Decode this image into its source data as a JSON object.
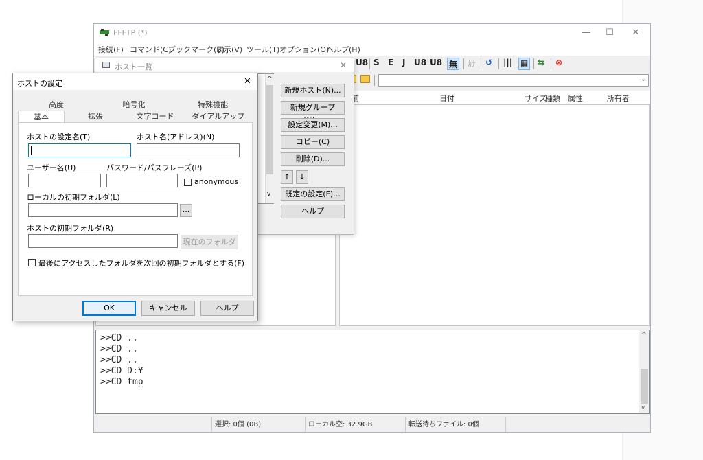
{
  "main": {
    "title": "FFFTP (*)",
    "controls": {
      "minimize": "—",
      "maximize": "☐",
      "close": "✕"
    },
    "menu": [
      "接続(F)",
      "コマンド(C)",
      "ブックマーク(B)",
      "表示(V)",
      "ツール(T)",
      "オプション(O)",
      "ヘルプ(H)"
    ],
    "toolbar": [
      "U8",
      "S",
      "E",
      "J",
      "U8",
      "U8",
      "無",
      "ｶﾅ",
      "↺",
      "|||",
      "▦",
      "⇆",
      "⊗"
    ],
    "file_columns": [
      "前",
      "日付",
      "サイズ",
      "種類",
      "属性",
      "所有者"
    ],
    "log": [
      ">>CD ..",
      ">>CD ..",
      ">>CD ..",
      ">>CD D:¥",
      ">>CD tmp"
    ],
    "status": [
      "",
      "選択: 0個 (0B)",
      "ローカル空: 32.9GB",
      "転送待ちファイル: 0個"
    ]
  },
  "hostlist": {
    "title": "ホスト一覧",
    "close": "✕",
    "buttons": [
      "新規ホスト(N)...",
      "新規グループ(G)...",
      "設定変更(M)...",
      "コピー(C)",
      "削除(D)...",
      "↑",
      "↓",
      "既定の設定(F)...",
      "ヘルプ"
    ]
  },
  "dialog": {
    "title": "ホストの設定",
    "close": "✕",
    "tabs_back": [
      "高度",
      "暗号化",
      "特殊機能"
    ],
    "tabs_front": [
      "基本",
      "拡張",
      "文字コード",
      "ダイアルアップ"
    ],
    "fields": {
      "host_setting_name": "ホストの設定名(T)",
      "host_name": "ホスト名(アドレス)(N)",
      "user_name": "ユーザー名(U)",
      "password": "パスワード/パスフレーズ(P)",
      "anonymous": "anonymous",
      "local_folder": "ローカルの初期フォルダ(L)",
      "browse": "...",
      "host_folder": "ホストの初期フォルダ(R)",
      "current_folder": "現在のフォルダ",
      "last_folder": "最後にアクセスしたフォルダを次回の初期フォルダとする(F)"
    },
    "buttons": {
      "ok": "OK",
      "cancel": "キャンセル",
      "help": "ヘルプ"
    }
  },
  "colors": {
    "accent": "#0078d7",
    "icon_green": "#2e8b2e",
    "icon_red": "#e0261b"
  }
}
